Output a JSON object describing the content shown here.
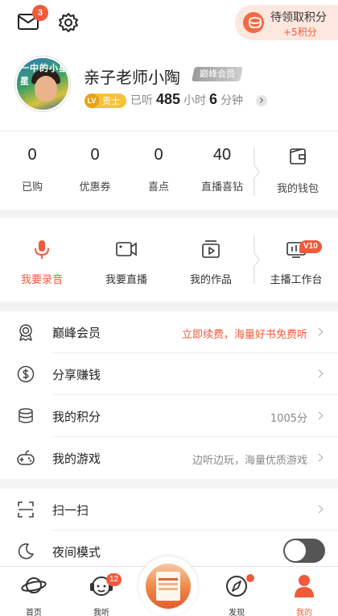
{
  "topbar": {
    "mail_badge": "3",
    "points_title": "待领取积分",
    "points_sub": "+5积分"
  },
  "profile": {
    "avatar_text": "一中的小星星",
    "name": "亲子老师小陶",
    "vip_tag": "巅峰会员",
    "level_lv": "LV",
    "level_name": "贡士",
    "listened_prefix": "已听",
    "hours": "485",
    "hours_unit": "小时",
    "minutes": "6",
    "minutes_unit": "分钟"
  },
  "stats": [
    {
      "value": "0",
      "label": "已购"
    },
    {
      "value": "0",
      "label": "优惠券"
    },
    {
      "value": "0",
      "label": "喜点"
    },
    {
      "value": "40",
      "label": "直播喜钻"
    }
  ],
  "wallet": {
    "label": "我的钱包"
  },
  "actions": [
    {
      "label": "我要录音"
    },
    {
      "label": "我要直播"
    },
    {
      "label": "我的作品"
    },
    {
      "label": "主播工作台"
    }
  ],
  "studio_badge": "V10",
  "menu": [
    {
      "label": "巅峰会员",
      "right": "立即续费，海量好书免费听"
    },
    {
      "label": "分享赚钱",
      "right": ""
    },
    {
      "label": "我的积分",
      "right": "1005分"
    },
    {
      "label": "我的游戏",
      "right": "边听边玩，海量优质游戏"
    }
  ],
  "menu2": [
    {
      "label": "扫一扫"
    },
    {
      "label": "夜间模式"
    }
  ],
  "tabs": [
    {
      "label": "首页"
    },
    {
      "label": "我听"
    },
    {
      "label": "发现"
    },
    {
      "label": "我的"
    }
  ],
  "tab_badge": "12",
  "colors": {
    "accent": "#f05a3a",
    "background": "#f3f3f3"
  }
}
